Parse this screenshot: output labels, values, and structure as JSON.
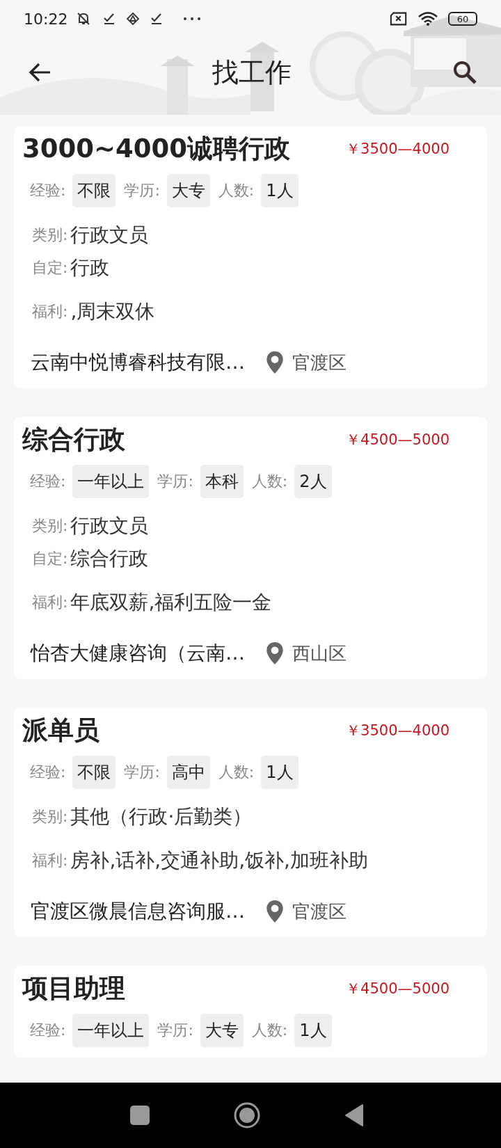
{
  "status_bar": {
    "time": "10:22",
    "battery": "60"
  },
  "header": {
    "title": "找工作"
  },
  "jobs": [
    {
      "title": "3000~4000诚聘行政",
      "salary": "￥3500—4000",
      "tags": [
        {
          "label": "经验:",
          "value": "不限"
        },
        {
          "label": "学历:",
          "value": "大专"
        },
        {
          "label": "人数:",
          "value": "1人"
        }
      ],
      "details": [
        {
          "label": "类别:",
          "value": "行政文员"
        },
        {
          "label": "自定:",
          "value": "行政"
        }
      ],
      "benefits": {
        "label": "福利:",
        "value": ",周末双休"
      },
      "company": "云南中悦博睿科技有限…",
      "district": "官渡区"
    },
    {
      "title": "综合行政",
      "salary": "￥4500—5000",
      "tags": [
        {
          "label": "经验:",
          "value": "一年以上"
        },
        {
          "label": "学历:",
          "value": "本科"
        },
        {
          "label": "人数:",
          "value": "2人"
        }
      ],
      "details": [
        {
          "label": "类别:",
          "value": "行政文员"
        },
        {
          "label": "自定:",
          "value": "综合行政"
        }
      ],
      "benefits": {
        "label": "福利:",
        "value": "年底双薪,福利五险一金"
      },
      "company": "怡杏大健康咨询（云南…",
      "district": "西山区"
    },
    {
      "title": "派单员",
      "salary": "￥3500—4000",
      "tags": [
        {
          "label": "经验:",
          "value": "不限"
        },
        {
          "label": "学历:",
          "value": "高中"
        },
        {
          "label": "人数:",
          "value": "1人"
        }
      ],
      "details": [
        {
          "label": "类别:",
          "value": "其他（行政·后勤类）"
        }
      ],
      "benefits": {
        "label": "福利:",
        "value": "房补,话补,交通补助,饭补,加班补助"
      },
      "company": "官渡区微晨信息咨询服…",
      "district": "官渡区"
    },
    {
      "title": "项目助理",
      "salary": "￥4500—5000",
      "tags": [
        {
          "label": "经验:",
          "value": "一年以上"
        },
        {
          "label": "学历:",
          "value": "大专"
        },
        {
          "label": "人数:",
          "value": "1人"
        }
      ]
    }
  ]
}
